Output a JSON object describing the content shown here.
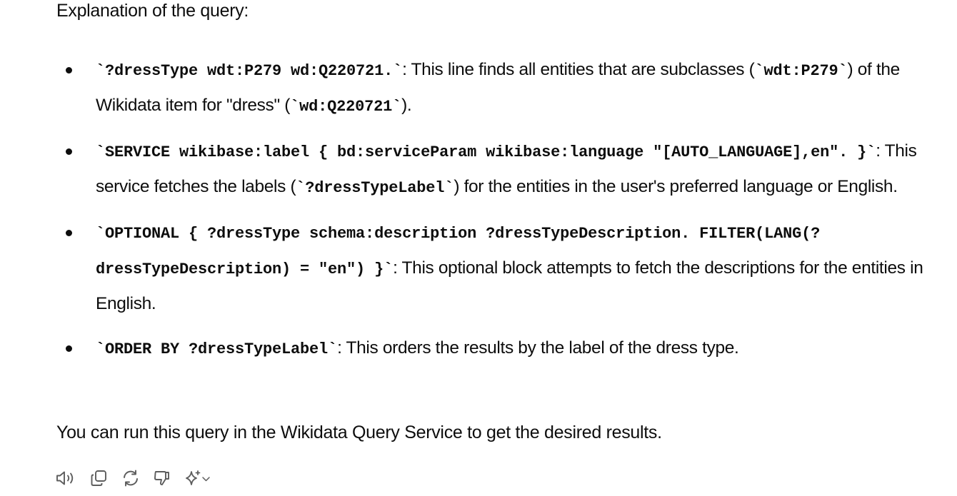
{
  "message": {
    "intro": "Explanation of the query:",
    "bullets": [
      {
        "code": "`?dressType wdt:P279 wd:Q220721.`",
        "text_a": ": This line finds all entities that are subclasses (",
        "code_b": "`wdt:P279`",
        "text_b": ") of the Wikidata item for \"dress\" (",
        "code_c": "`wd:Q220721`",
        "text_c": ")."
      },
      {
        "code": "`SERVICE wikibase:label { bd:serviceParam wikibase:language \"[AUTO_LANGUAGE],en\". }`",
        "text_a": ": This service fetches the labels (",
        "code_b": "`?dressTypeLabel`",
        "text_b": ") for the entities in the user's preferred language or English."
      },
      {
        "code": "`OPTIONAL { ?dressType schema:description ?dressTypeDescription. FILTER(LANG(?dressTypeDescription) = \"en\") }`",
        "text_a": ": This optional block attempts to fetch the descriptions for the entities in English."
      },
      {
        "code": "`ORDER BY ?dressTypeLabel`",
        "text_a": ": This orders the results by the label of the dress type."
      }
    ],
    "outro": "You can run this query in the Wikidata Query Service to get the desired results."
  },
  "actions": [
    {
      "name": "read-aloud-icon"
    },
    {
      "name": "copy-icon"
    },
    {
      "name": "regenerate-icon"
    },
    {
      "name": "thumbs-down-icon"
    },
    {
      "name": "sparkle-model-icon"
    }
  ],
  "colors": {
    "text": "#0d0d0d",
    "icon": "#5d5d5d",
    "background": "#ffffff"
  }
}
